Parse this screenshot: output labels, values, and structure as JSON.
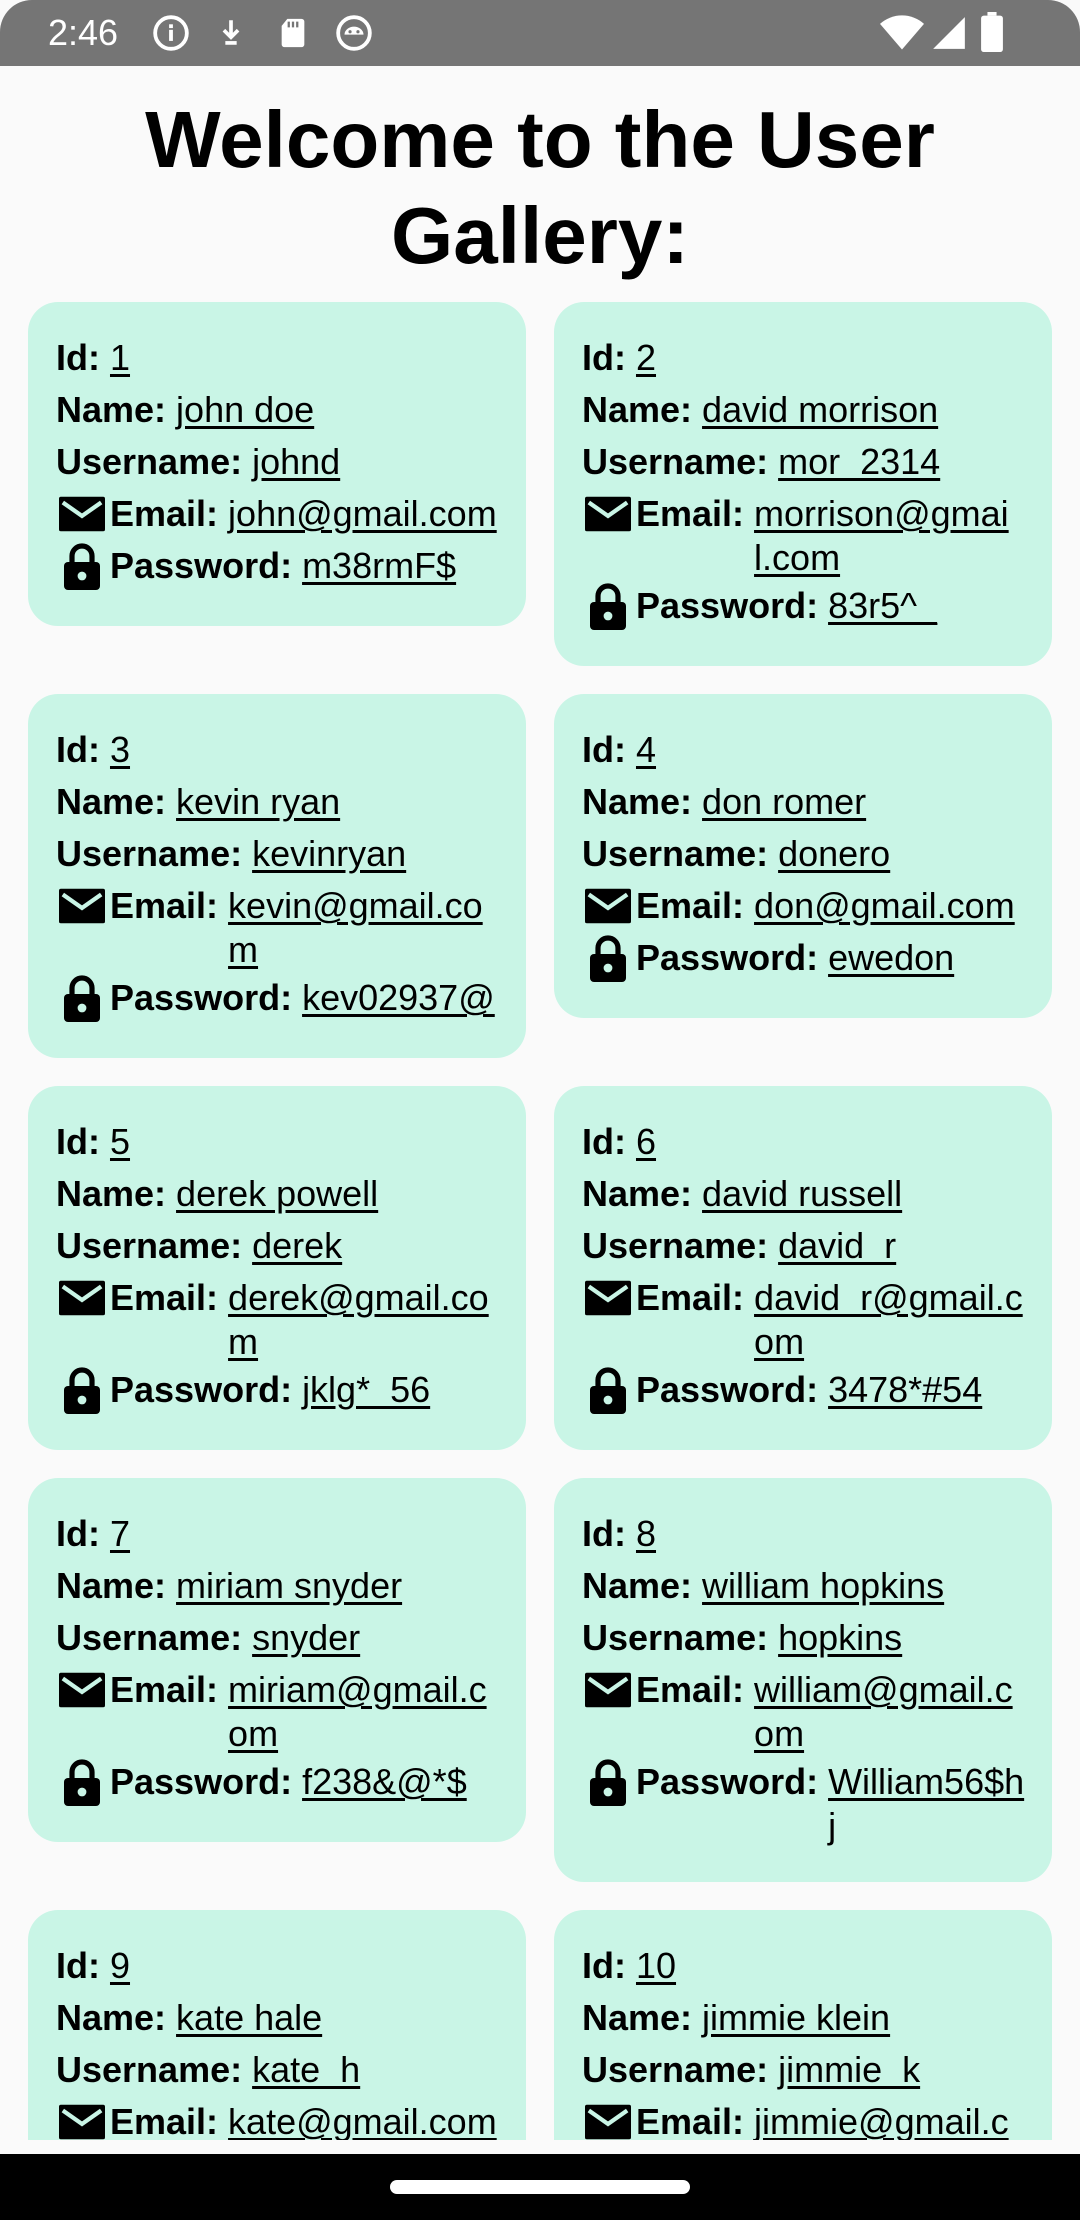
{
  "status_bar": {
    "time": "2:46"
  },
  "page": {
    "title": "Welcome to the User Gallery:"
  },
  "labels": {
    "id": "Id:",
    "name": "Name:",
    "username": "Username:",
    "email": "Email:",
    "password": "Password:"
  },
  "icons": {
    "email": "email-icon",
    "password": "lock-icon"
  },
  "users": [
    {
      "id": "1",
      "name": "john doe",
      "username": "johnd",
      "email": "john@gmail.com",
      "password": "m38rmF$"
    },
    {
      "id": "2",
      "name": "david morrison",
      "username": "mor_2314",
      "email": "morrison@gmail.com",
      "password": "83r5^_"
    },
    {
      "id": "3",
      "name": "kevin ryan",
      "username": "kevinryan",
      "email": "kevin@gmail.com",
      "password": "kev02937@"
    },
    {
      "id": "4",
      "name": "don romer",
      "username": "donero",
      "email": "don@gmail.com",
      "password": "ewedon"
    },
    {
      "id": "5",
      "name": "derek powell",
      "username": "derek",
      "email": "derek@gmail.com",
      "password": "jklg*_56"
    },
    {
      "id": "6",
      "name": "david russell",
      "username": "david_r",
      "email": "david_r@gmail.com",
      "password": "3478*#54"
    },
    {
      "id": "7",
      "name": "miriam snyder",
      "username": "snyder",
      "email": "miriam@gmail.com",
      "password": "f238&@*$"
    },
    {
      "id": "8",
      "name": "william hopkins",
      "username": "hopkins",
      "email": "william@gmail.com",
      "password": "William56$hj"
    },
    {
      "id": "9",
      "name": "kate hale",
      "username": "kate_h",
      "email": "kate@gmail.com",
      "password": ""
    },
    {
      "id": "10",
      "name": "jimmie klein",
      "username": "jimmie_k",
      "email": "jimmie@gmail.com",
      "password": ""
    }
  ],
  "colors": {
    "card": "#c9f5e6",
    "status_bar": "#757575",
    "background": "#fafafa"
  }
}
